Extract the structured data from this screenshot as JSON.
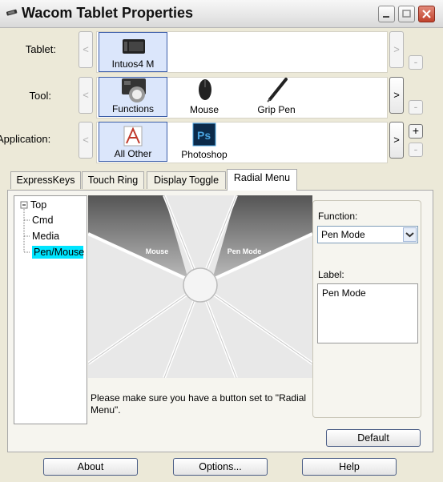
{
  "window": {
    "title": "Wacom Tablet Properties"
  },
  "rows": {
    "tablet": {
      "label": "Tablet:",
      "items": [
        {
          "label": "Intuos4 M"
        }
      ]
    },
    "tool": {
      "label": "Tool:",
      "items": [
        {
          "label": "Functions"
        },
        {
          "label": "Mouse"
        },
        {
          "label": "Grip Pen"
        }
      ]
    },
    "application": {
      "label": "Application:",
      "items": [
        {
          "label": "All Other"
        },
        {
          "label": "Photoshop"
        }
      ]
    }
  },
  "buttons": {
    "nav_prev": "<",
    "nav_next": ">",
    "add": "+",
    "remove": "-"
  },
  "tabs": [
    {
      "label": "ExpressKeys"
    },
    {
      "label": "Touch Ring"
    },
    {
      "label": "Display Toggle"
    },
    {
      "label": "Radial Menu"
    }
  ],
  "tree": {
    "items": [
      {
        "label": "Top"
      },
      {
        "label": "Cmd"
      },
      {
        "label": "Media"
      },
      {
        "label": "Pen/Mouse"
      }
    ]
  },
  "radial": {
    "segments": [
      {
        "label": "Mouse"
      },
      {
        "label": "Pen Mode"
      }
    ],
    "note": "Please make sure you have a button set to \"Radial Menu\"."
  },
  "function": {
    "label": "Function:",
    "value": "Pen Mode"
  },
  "label_field": {
    "label": "Label:",
    "value": "Pen Mode"
  },
  "footer": {
    "default": "Default",
    "about": "About",
    "options": "Options...",
    "help": "Help"
  }
}
